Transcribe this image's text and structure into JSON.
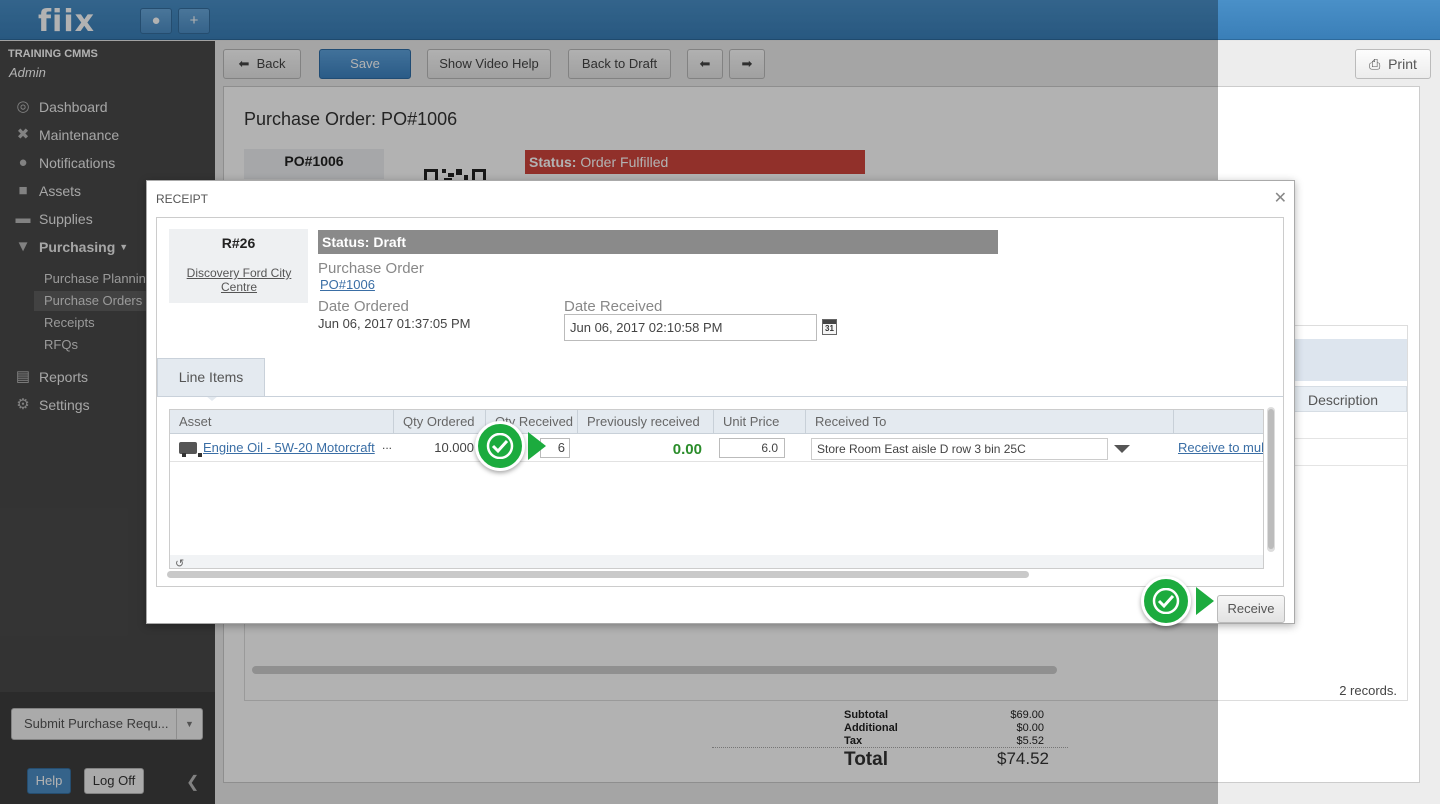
{
  "app": {
    "logo_text": "fiix",
    "top_icons": [
      "user-icon",
      "plus-icon"
    ]
  },
  "sidebar": {
    "org_name": "TRAINING CMMS",
    "role": "Admin",
    "items": [
      {
        "label": "Dashboard",
        "icon": "dashboard-icon"
      },
      {
        "label": "Maintenance",
        "icon": "tools-icon"
      },
      {
        "label": "Notifications",
        "icon": "chat-icon"
      },
      {
        "label": "Assets",
        "icon": "box-icon"
      },
      {
        "label": "Supplies",
        "icon": "truck-icon"
      },
      {
        "label": "Purchasing",
        "icon": "cart-icon"
      },
      {
        "label": "Reports",
        "icon": "chart-icon"
      },
      {
        "label": "Settings",
        "icon": "gear-icon"
      }
    ],
    "purchasing_sub": [
      "Purchase Planning",
      "Purchase Orders",
      "Receipts",
      "RFQs"
    ],
    "submit_label": "Submit Purchase Requ...",
    "help_label": "Help",
    "logoff_label": "Log Off"
  },
  "toolbar": {
    "back_label": "Back",
    "save_label": "Save",
    "video_help_label": "Show Video Help",
    "back_to_draft_label": "Back to Draft",
    "print_label": "Print"
  },
  "po": {
    "title": "Purchase Order: PO#1006",
    "number": "PO#1006",
    "status_prefix": "Status:",
    "status_value": "Order Fulfilled",
    "grid_col_description": "Description",
    "records": "2 records.",
    "totals": {
      "subtotal_label": "Subtotal",
      "subtotal": "$69.00",
      "additional_label": "Additional",
      "additional": "$0.00",
      "tax_label": "Tax",
      "tax": "$5.52",
      "total_label": "Total",
      "total": "$74.52"
    }
  },
  "receipt": {
    "title": "RECEIPT",
    "number": "R#26",
    "location": "Discovery Ford City Centre",
    "status": "Status: Draft",
    "po_label": "Purchase Order",
    "po_link": "PO#1006",
    "date_ordered_label": "Date Ordered",
    "date_ordered": "Jun 06, 2017 01:37:05 PM",
    "date_received_label": "Date Received",
    "date_received": "Jun 06, 2017 02:10:58 PM",
    "tab_label": "Line Items",
    "columns": [
      "Asset",
      "Qty Ordered",
      "Qty Received",
      "Previously received",
      "Unit Price",
      "Received To"
    ],
    "row": {
      "asset": "Engine Oil - 5W-20 Motorcraft",
      "asset_more": "...",
      "qty_ordered": "10.000",
      "qty_received": "6",
      "previously_received": "0.00",
      "unit_price": "6.0",
      "received_to": "Store Room East aisle D row 3 bin 25C",
      "multi_link": "Receive to mul"
    },
    "receive_label": "Receive"
  }
}
